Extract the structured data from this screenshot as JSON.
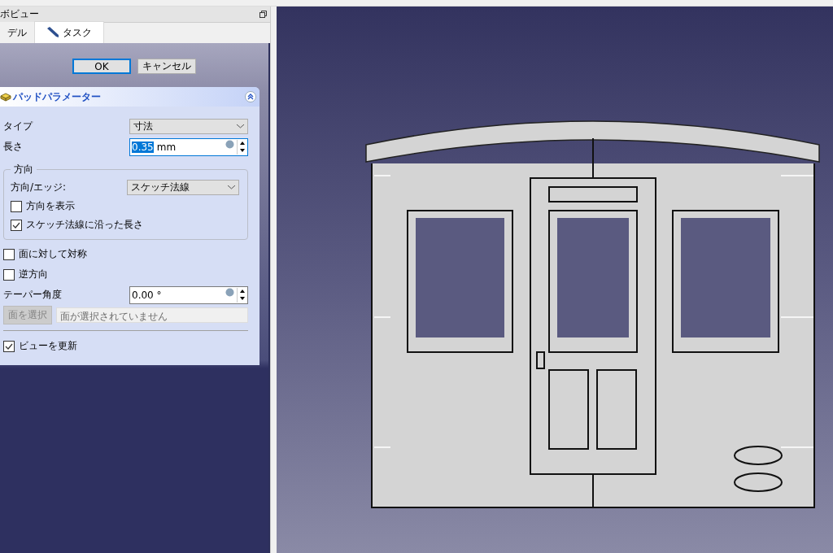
{
  "panel": {
    "title": "ボビュー"
  },
  "tabs": [
    {
      "label": "デル",
      "selected": false
    },
    {
      "label": "タスク",
      "selected": true
    }
  ],
  "buttons": [
    {
      "label": "OK",
      "selected": true
    },
    {
      "label": "キャンセル",
      "selected": false
    }
  ],
  "section": {
    "title": "パッドパラメーター",
    "expanded": true
  },
  "fields": [
    {
      "kind": "dropdown",
      "label": "タイプ",
      "value": "寸法"
    },
    {
      "kind": "spin",
      "label": "長さ",
      "value": "0.35",
      "unit": "mm",
      "selected": true
    }
  ],
  "group": {
    "title": "方向",
    "items": [
      {
        "kind": "dropdown",
        "label": "方向/エッジ:",
        "value": "スケッチ法線"
      },
      {
        "kind": "checkbox",
        "label": "方向を表示",
        "checked": false
      },
      {
        "kind": "checkbox",
        "label": "スケッチ法線に沿った長さ",
        "checked": true
      }
    ]
  },
  "options": [
    {
      "kind": "checkbox",
      "label": "面に対して対称",
      "checked": false
    },
    {
      "kind": "checkbox",
      "label": "逆方向",
      "checked": false
    },
    {
      "kind": "spin",
      "label": "テーパー角度",
      "value": "0.00 °",
      "selected": false
    },
    {
      "kind": "face",
      "button": "面を選択",
      "disabled": true,
      "placeholder": "面が選択されていません"
    }
  ],
  "refresh": {
    "label": "ビューを更新",
    "checked": true
  }
}
